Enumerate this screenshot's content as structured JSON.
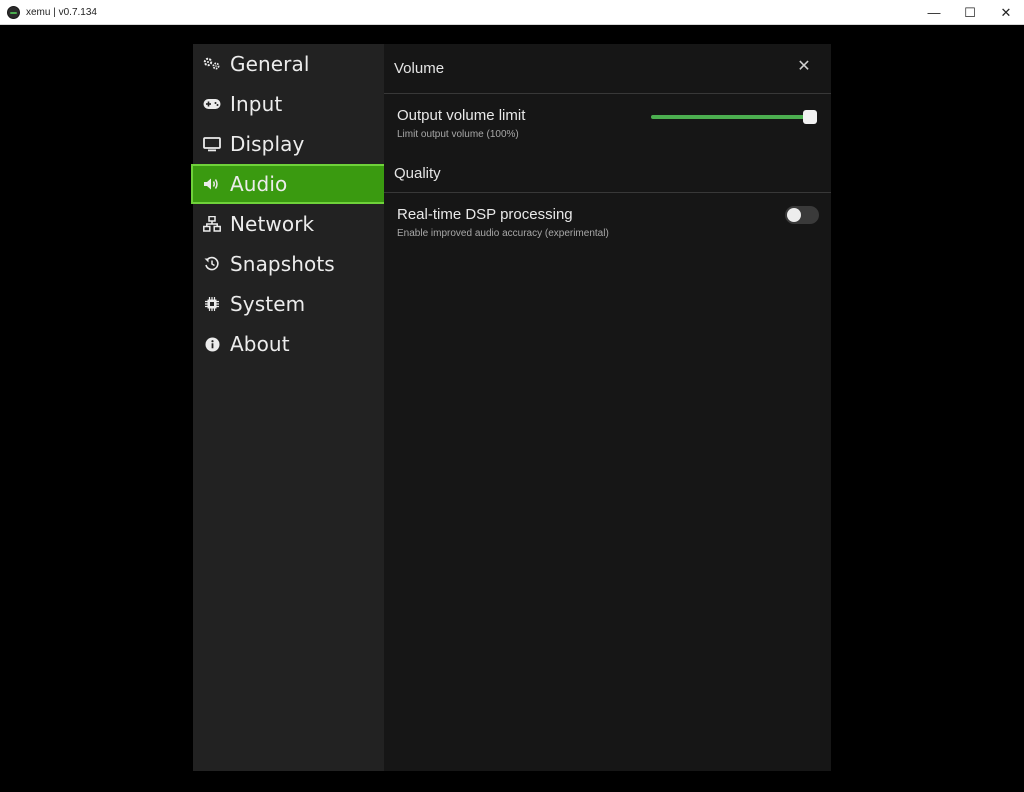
{
  "window": {
    "title": "xemu | v0.7.134",
    "controls": {
      "minimize": "—",
      "maximize": "☐",
      "close": "✕"
    }
  },
  "sidebar": {
    "items": [
      {
        "label": "General",
        "icon": "gears-icon",
        "active": false
      },
      {
        "label": "Input",
        "icon": "gamepad-icon",
        "active": false
      },
      {
        "label": "Display",
        "icon": "monitor-icon",
        "active": false
      },
      {
        "label": "Audio",
        "icon": "speaker-icon",
        "active": true
      },
      {
        "label": "Network",
        "icon": "network-icon",
        "active": false
      },
      {
        "label": "Snapshots",
        "icon": "history-icon",
        "active": false
      },
      {
        "label": "System",
        "icon": "chip-icon",
        "active": false
      },
      {
        "label": "About",
        "icon": "info-icon",
        "active": false
      }
    ]
  },
  "content": {
    "close_label": "✕",
    "sections": {
      "volume": {
        "title": "Volume",
        "output_volume": {
          "title": "Output volume limit",
          "description": "Limit output volume (100%)",
          "value": 1.0
        }
      },
      "quality": {
        "title": "Quality",
        "dsp": {
          "title": "Real-time DSP processing",
          "description": "Enable improved audio accuracy (experimental)",
          "enabled": false
        }
      }
    }
  },
  "colors": {
    "accent": "#3a9a10",
    "accent_border": "#6fd23a",
    "slider": "#4caf50",
    "sidebar_bg": "#222222",
    "content_bg": "#161616"
  }
}
